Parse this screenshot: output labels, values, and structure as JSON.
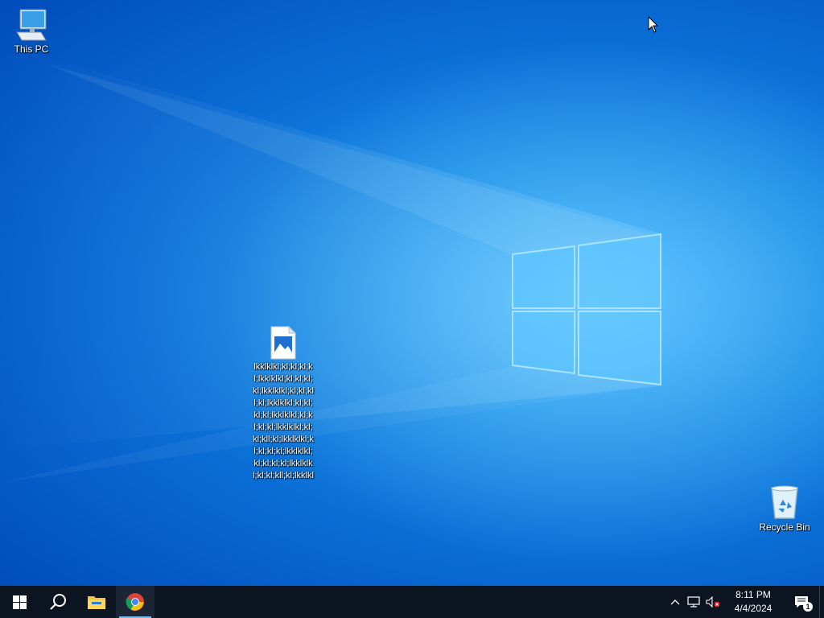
{
  "desktop": {
    "icons": [
      {
        "label": "This PC",
        "icon": "this-pc-icon"
      },
      {
        "label": "lkklklkl;kl;kl;kl;kl;lkklklkl;kl;kl;kl;kl;lkklklkl;kl;kl;kll;kl;lkklklkl;kl;kl;kl;kl;lkklklkl;kl;kl;kl;kl;lkklklkl;kl;kl;kll;kl;lkklklkl;kl;kl;kl;kl;lkklklkl;kl;kl;kl;kl;lkklklkl;kl;kl;kll;kl;lkklkl",
        "icon": "image-file-icon"
      },
      {
        "label": "Recycle Bin",
        "icon": "recycle-bin-icon"
      }
    ]
  },
  "taskbar": {
    "start": "windows-start-icon",
    "search": "search-icon",
    "apps": [
      {
        "name": "File Explorer",
        "icon": "folder-icon"
      },
      {
        "name": "Google Chrome",
        "icon": "chrome-icon",
        "active": true
      }
    ],
    "tray": {
      "icons": [
        "chevron-up-icon",
        "network-icon",
        "volume-muted-icon"
      ],
      "time": "8:11 PM",
      "date": "4/4/2024",
      "notifications_count": "1"
    }
  },
  "colors": {
    "taskbar_bg": "#0c1422",
    "wallpaper_accent": "#0a6fd6"
  }
}
